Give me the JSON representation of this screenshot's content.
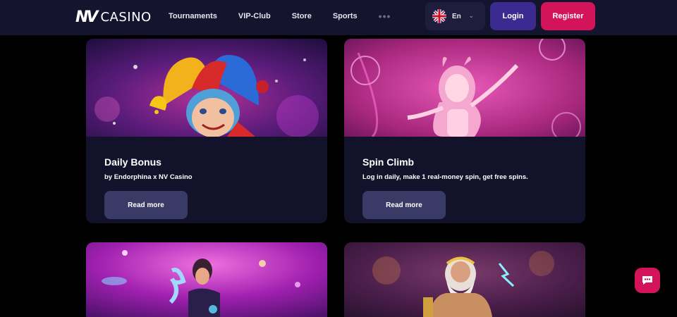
{
  "header": {
    "logo_mark": "NV",
    "logo_text": "CASINO",
    "nav": [
      "Tournaments",
      "VIP-Club",
      "Store",
      "Sports"
    ],
    "more": "•••",
    "language": "En",
    "login": "Login",
    "register": "Register"
  },
  "cards": [
    {
      "title": "Daily Bonus",
      "subtitle": "by Endorphina x NV Casino",
      "button": "Read more"
    },
    {
      "title": "Spin Climb",
      "subtitle": "Log in daily, make 1 real-money spin, get free spins.",
      "button": "Read more"
    }
  ],
  "colors": {
    "header_bg": "#15142e",
    "card_bg": "#13122b",
    "accent": "#d3135a",
    "login": "#3b2a8f"
  },
  "icons": [
    "uk-flag-icon",
    "chevron-down-icon",
    "chat-icon"
  ]
}
